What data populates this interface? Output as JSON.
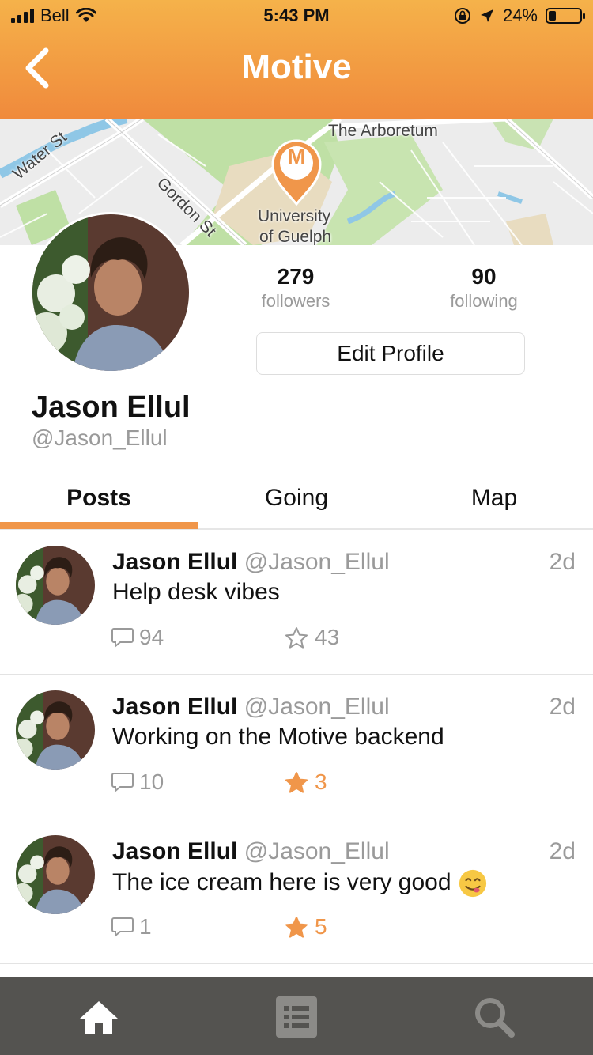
{
  "status_bar": {
    "carrier": "Bell",
    "time": "5:43 PM",
    "battery": "24%",
    "battery_level": 0.24
  },
  "header": {
    "title": "Motive"
  },
  "map": {
    "labels": {
      "arboretum": "The Arboretum",
      "water_st": "Water St",
      "gordon_st": "Gordon St",
      "university_line1": "University",
      "university_line2": "of Guelph"
    },
    "marker_letter": "M"
  },
  "profile": {
    "name": "Jason Ellul",
    "handle": "@Jason_Ellul",
    "followers_count": "279",
    "followers_label": "followers",
    "following_count": "90",
    "following_label": "following",
    "edit_button": "Edit Profile"
  },
  "tabs": [
    {
      "label": "Posts",
      "active": true
    },
    {
      "label": "Going",
      "active": false
    },
    {
      "label": "Map",
      "active": false
    }
  ],
  "posts": [
    {
      "name": "Jason Ellul",
      "handle": "@Jason_Ellul",
      "age": "2d",
      "text": "Help desk vibes",
      "comments": "94",
      "stars": "43",
      "starred": false,
      "emoji": ""
    },
    {
      "name": "Jason Ellul",
      "handle": "@Jason_Ellul",
      "age": "2d",
      "text": "Working on the Motive backend",
      "comments": "10",
      "stars": "3",
      "starred": true,
      "emoji": ""
    },
    {
      "name": "Jason Ellul",
      "handle": "@Jason_Ellul",
      "age": "2d",
      "text": "The ice cream here is very good",
      "comments": "1",
      "stars": "5",
      "starred": true,
      "emoji": "yum-face-emoji"
    }
  ],
  "bottom_nav": [
    {
      "icon": "home-icon",
      "active": true
    },
    {
      "icon": "list-icon",
      "active": false
    },
    {
      "icon": "search-icon",
      "active": false
    }
  ],
  "colors": {
    "accent": "#f0964a",
    "header_top": "#f5b24a",
    "header_bottom": "#f08a3c",
    "tabbar": "#545350"
  }
}
